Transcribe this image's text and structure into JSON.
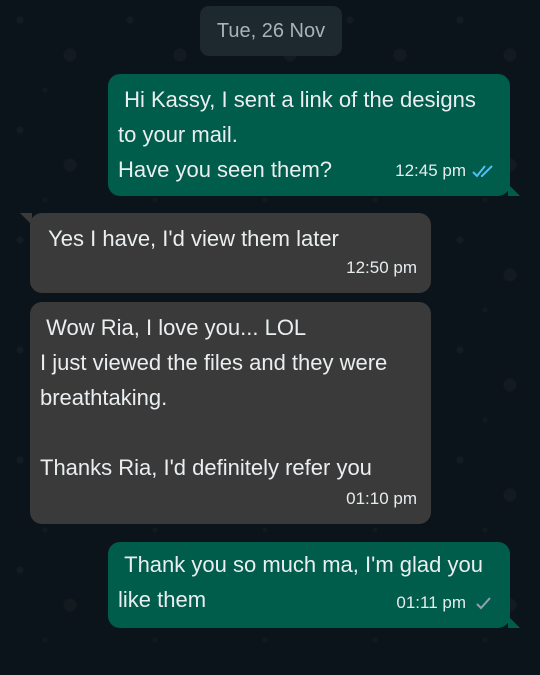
{
  "date_chip": "Tue, 26 Nov",
  "messages": [
    {
      "direction": "outgoing",
      "text": " Hi Kassy, I sent a link of the designs\nto your mail.\nHave you seen them?",
      "time": "12:45 pm",
      "status": "read",
      "tick_color": "#53bdeb"
    },
    {
      "direction": "incoming",
      "text": " Yes I have, I'd view them later",
      "time": "12:50 pm"
    },
    {
      "direction": "incoming",
      "text": " Wow Ria, I love you... LOL\nI just viewed the files and they were\nbreathtaking.\n\nThanks Ria, I'd definitely refer you",
      "time": "01:10 pm"
    },
    {
      "direction": "outgoing",
      "text": " Thank you so much ma, I'm glad you\nlike them",
      "time": "01:11 pm",
      "status": "delivered",
      "tick_color": "#8fa3ad"
    }
  ]
}
